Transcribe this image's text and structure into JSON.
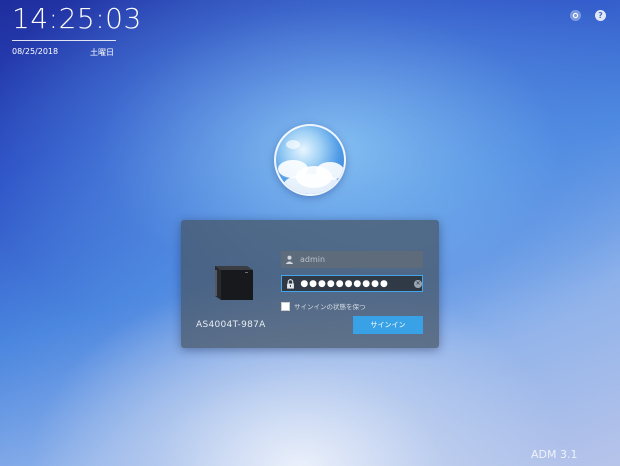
{
  "clock": {
    "time": "14:25:03",
    "date": "08/25/2018",
    "weekday": "土曜日"
  },
  "top_icons": [
    {
      "name": "settings-icon"
    },
    {
      "name": "help-icon",
      "glyph": "?"
    }
  ],
  "login": {
    "model_name": "AS4004T-987A",
    "username": {
      "value": "",
      "placeholder": "admin"
    },
    "password": {
      "value": "●●●●●●●●●●"
    },
    "remember_label": "サインインの状態を保つ",
    "remember_checked": false,
    "signin_label": "サインイン"
  },
  "footer": {
    "version": "ADM 3.1"
  },
  "colors": {
    "accent": "#39a2e6",
    "panel": "#46555f",
    "field_border": "#47a4e8"
  }
}
